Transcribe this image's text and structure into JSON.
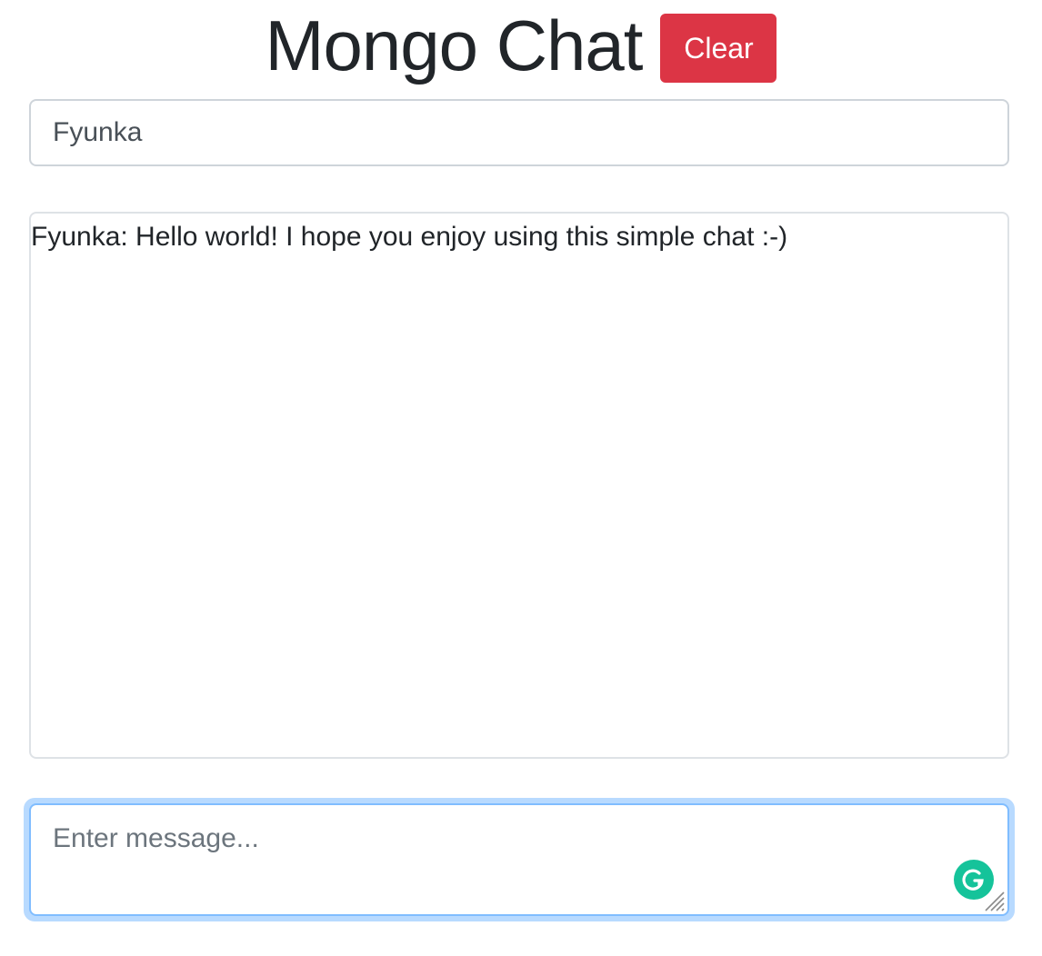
{
  "header": {
    "title": "Mongo Chat",
    "clear_label": "Clear"
  },
  "username": {
    "value": "Fyunka"
  },
  "messages": [
    {
      "text": "Fyunka: Hello world! I hope you enjoy using this simple chat :-)"
    }
  ],
  "compose": {
    "placeholder": "Enter message...",
    "value": ""
  },
  "icons": {
    "grammarly": "grammarly-icon",
    "resize": "resize-handle-icon"
  },
  "colors": {
    "clear_button": "#dc3545",
    "focus_ring": "#b8daff",
    "focus_border": "#80bdff",
    "grammarly": "#15c39a"
  }
}
